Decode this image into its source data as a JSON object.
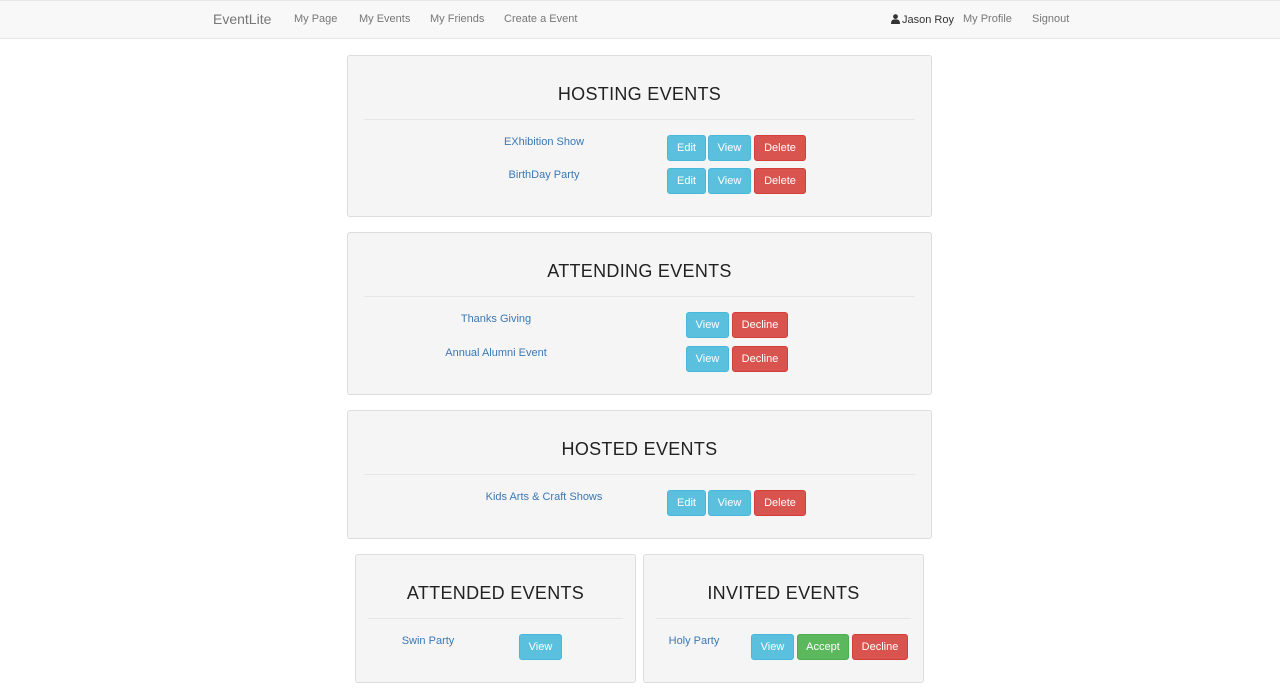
{
  "nav": {
    "brand": "EventLite",
    "links": [
      "My Page",
      "My Events",
      "My Friends",
      "Create a Event"
    ],
    "user_name": "Jason Roy",
    "profile": "My Profile",
    "signout": "Signout"
  },
  "hosting": {
    "title": "HOSTING EVENTS",
    "events": [
      {
        "name": "EXhibition Show",
        "edit": "Edit",
        "view": "View",
        "delete": "Delete"
      },
      {
        "name": "BirthDay Party",
        "edit": "Edit",
        "view": "View",
        "delete": "Delete"
      }
    ]
  },
  "attending": {
    "title": "ATTENDING EVENTS",
    "events": [
      {
        "name": "Thanks Giving",
        "view": "View",
        "decline": "Decline"
      },
      {
        "name": "Annual Alumni Event",
        "view": "View",
        "decline": "Decline"
      }
    ]
  },
  "hosted": {
    "title": "HOSTED EVENTS",
    "events": [
      {
        "name": "Kids Arts & Craft Shows",
        "edit": "Edit",
        "view": "View",
        "delete": "Delete"
      }
    ]
  },
  "attended": {
    "title": "ATTENDED EVENTS",
    "events": [
      {
        "name": "Swin Party",
        "view": "View"
      }
    ]
  },
  "invited": {
    "title": "INVITED EVENTS",
    "events": [
      {
        "name": "Holy Party",
        "view": "View",
        "accept": "Accept",
        "decline": "Decline"
      }
    ]
  },
  "colors": {
    "info": "#5bc0de",
    "danger": "#d9534f",
    "success": "#5cb85c",
    "link": "#3a78b5"
  }
}
